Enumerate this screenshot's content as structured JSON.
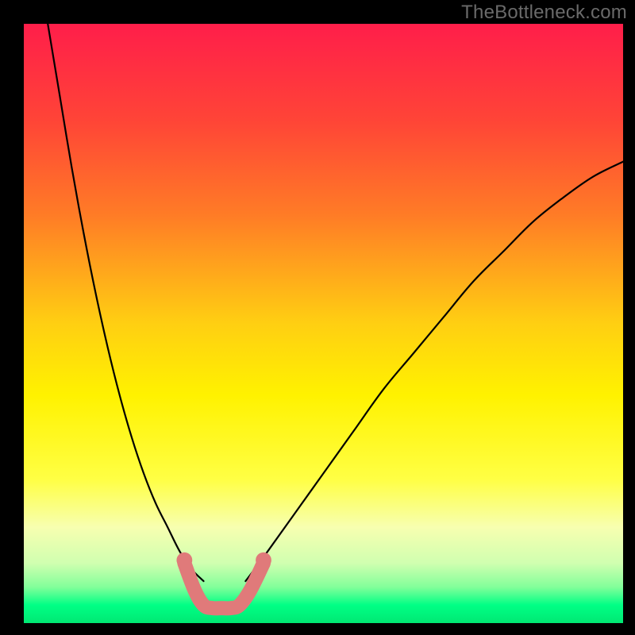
{
  "watermark": "TheBottleneck.com",
  "chart_data": {
    "type": "line",
    "title": "",
    "xlabel": "",
    "ylabel": "",
    "xlim": [
      0,
      1
    ],
    "ylim": [
      0,
      1
    ],
    "gradient_stops": [
      {
        "offset": 0.0,
        "color": "#ff1e4a"
      },
      {
        "offset": 0.16,
        "color": "#ff4437"
      },
      {
        "offset": 0.32,
        "color": "#ff7c26"
      },
      {
        "offset": 0.5,
        "color": "#ffcf12"
      },
      {
        "offset": 0.62,
        "color": "#fff200"
      },
      {
        "offset": 0.76,
        "color": "#ffff44"
      },
      {
        "offset": 0.84,
        "color": "#f7ffb0"
      },
      {
        "offset": 0.9,
        "color": "#d0ffb0"
      },
      {
        "offset": 0.94,
        "color": "#82ff9a"
      },
      {
        "offset": 0.97,
        "color": "#00ff85"
      },
      {
        "offset": 1.0,
        "color": "#00e873"
      }
    ],
    "series": [
      {
        "name": "left_curve",
        "x": [
          0.04,
          0.06,
          0.08,
          0.1,
          0.12,
          0.14,
          0.16,
          0.18,
          0.2,
          0.22,
          0.24,
          0.26,
          0.28,
          0.3
        ],
        "y": [
          1.0,
          0.88,
          0.76,
          0.65,
          0.55,
          0.46,
          0.38,
          0.31,
          0.25,
          0.2,
          0.16,
          0.12,
          0.09,
          0.07
        ]
      },
      {
        "name": "right_curve",
        "x": [
          0.37,
          0.4,
          0.45,
          0.5,
          0.55,
          0.6,
          0.65,
          0.7,
          0.75,
          0.8,
          0.85,
          0.9,
          0.95,
          1.0
        ],
        "y": [
          0.07,
          0.11,
          0.18,
          0.25,
          0.32,
          0.39,
          0.45,
          0.51,
          0.57,
          0.62,
          0.67,
          0.71,
          0.745,
          0.77
        ]
      }
    ],
    "sweet_spot": {
      "x": [
        0.268,
        0.285,
        0.3,
        0.315,
        0.33,
        0.345,
        0.36,
        0.378,
        0.4
      ],
      "y": [
        0.1,
        0.055,
        0.03,
        0.025,
        0.025,
        0.025,
        0.03,
        0.055,
        0.1
      ],
      "dots": [
        {
          "x": 0.268,
          "y": 0.105
        },
        {
          "x": 0.4,
          "y": 0.105
        }
      ],
      "stroke_color": "#e07a7a",
      "stroke_width": 18
    }
  }
}
